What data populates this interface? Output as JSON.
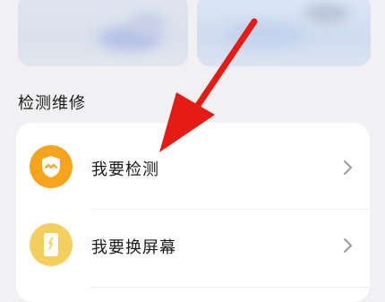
{
  "section": {
    "title": "检测维修"
  },
  "items": [
    {
      "label": "我要检测",
      "icon": "shield-wave-icon"
    },
    {
      "label": "我要换屏幕",
      "icon": "phone-screen-icon"
    }
  ],
  "colors": {
    "accent_orange": "#f5a41c",
    "accent_yellow": "#f4cf5e",
    "arrow_red": "#e41c14"
  }
}
